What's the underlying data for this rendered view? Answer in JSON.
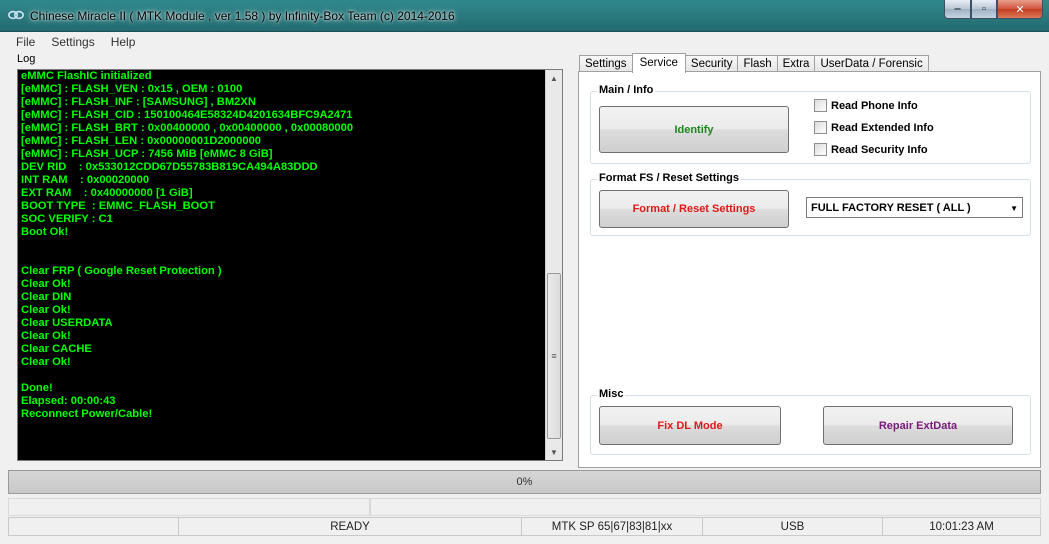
{
  "window": {
    "title": "Chinese Miracle II ( MTK Module , ver 1.58 ) by Infinity-Box Team (c) 2014-2016",
    "buttons": {
      "minimize": "‒",
      "maximize": "▫",
      "close": "✕"
    }
  },
  "menu": [
    "File",
    "Settings",
    "Help"
  ],
  "log": {
    "label": "Log",
    "lines": [
      "eMMC FlashIC initialized",
      "[eMMC] : FLASH_VEN : 0x15 , OEM : 0100",
      "[eMMC] : FLASH_INF : [SAMSUNG] , BM2XN",
      "[eMMC] : FLASH_CID : 150100464E58324D4201634BFC9A2471",
      "[eMMC] : FLASH_BRT : 0x00400000 , 0x00400000 , 0x00080000",
      "[eMMC] : FLASH_LEN : 0x00000001D2000000",
      "[eMMC] : FLASH_UCP : 7456 MiB [eMMC 8 GiB]",
      "DEV RID    : 0x533012CDD67D55783B819CA494A83DDD",
      "INT RAM    : 0x00020000",
      "EXT RAM    : 0x40000000 [1 GiB]",
      "BOOT TYPE  : EMMC_FLASH_BOOT",
      "SOC VERIFY : C1",
      "Boot Ok!",
      "",
      "",
      "Clear FRP ( Google Reset Protection )",
      "Clear Ok!",
      "Clear DIN",
      "Clear Ok!",
      "Clear USERDATA",
      "Clear Ok!",
      "Clear CACHE",
      "Clear Ok!",
      "",
      "Done!",
      "Elapsed: 00:00:43",
      "Reconnect Power/Cable!"
    ],
    "scroll_up": "▲",
    "scroll_down": "▼",
    "thumb_grip": "≡"
  },
  "tabs": [
    "Settings",
    "Service",
    "Security",
    "Flash",
    "Extra",
    "UserData / Forensic"
  ],
  "active_tab": "Service",
  "service": {
    "main_info": {
      "title": "Main / Info",
      "identify_button": "Identify",
      "checkboxes": [
        "Read Phone Info",
        "Read Extended Info",
        "Read Security Info"
      ]
    },
    "format": {
      "title": "Format FS / Reset Settings",
      "button": "Format / Reset Settings",
      "combo_value": "FULL FACTORY RESET ( ALL )",
      "combo_arrow": "▼"
    },
    "misc": {
      "title": "Misc",
      "fix_dl_button": "Fix DL Mode",
      "repair_button": "Repair ExtData"
    }
  },
  "progress": {
    "text": "0%",
    "fraction": 0
  },
  "status": {
    "cells": [
      "",
      "READY",
      "MTK SP 65|67|83|81|xx",
      "USB",
      "10:01:23 AM"
    ]
  },
  "colors": {
    "log_text": "#00ff00",
    "identify": "#1a8a1a",
    "format": "#e01818",
    "fix_dl": "#e01818",
    "repair": "#7a1a7a"
  }
}
